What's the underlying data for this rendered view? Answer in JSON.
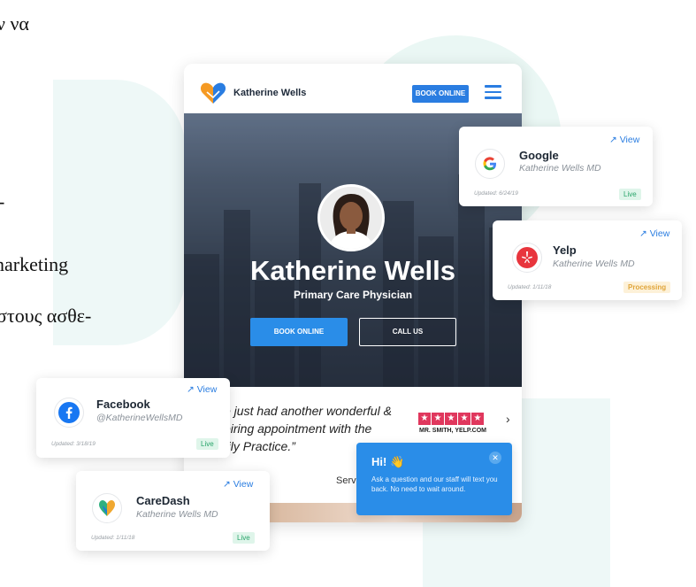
{
  "background_text": {
    "line1": "ν να",
    "line2": "-",
    "line3": "narketing",
    "line4": "στους ασθε-"
  },
  "site": {
    "brand": "Katherine Wells",
    "book_online_top": "BOOK ONLINE",
    "hero_name": "Katherine Wells",
    "hero_title": "Primary Care Physician",
    "book_online": "BOOK ONLINE",
    "call_us": "CALL US",
    "quote": "ve just had another wonderful & spiring appointment with the mily Practice.”",
    "reviewer": "MR. SMITH, YELP.COM",
    "services": "Servi",
    "accent_color": "#2a7de1",
    "star_color": "#e0375d"
  },
  "cards": {
    "google": {
      "title": "Google",
      "subtitle": "Katherine Wells MD",
      "view": "View",
      "updated": "Updated: 6/24/19",
      "status": "Live",
      "icon": "google-icon"
    },
    "yelp": {
      "title": "Yelp",
      "subtitle": "Katherine Wells MD",
      "view": "View",
      "updated": "Updated: 1/11/18",
      "status": "Processing",
      "icon": "yelp-icon"
    },
    "facebook": {
      "title": "Facebook",
      "subtitle": "@KatherineWellsMD",
      "view": "View",
      "updated": "Updated: 3/18/19",
      "status": "Live",
      "icon": "facebook-icon"
    },
    "caredash": {
      "title": "CareDash",
      "subtitle": "Katherine Wells MD",
      "view": "View",
      "updated": "Updated: 1/11/18",
      "status": "Live",
      "icon": "caredash-icon"
    }
  },
  "chat": {
    "greeting": "Hi! 👋",
    "message": "Ask a question and our staff will text you back. No need to wait around.",
    "close": "✕"
  }
}
